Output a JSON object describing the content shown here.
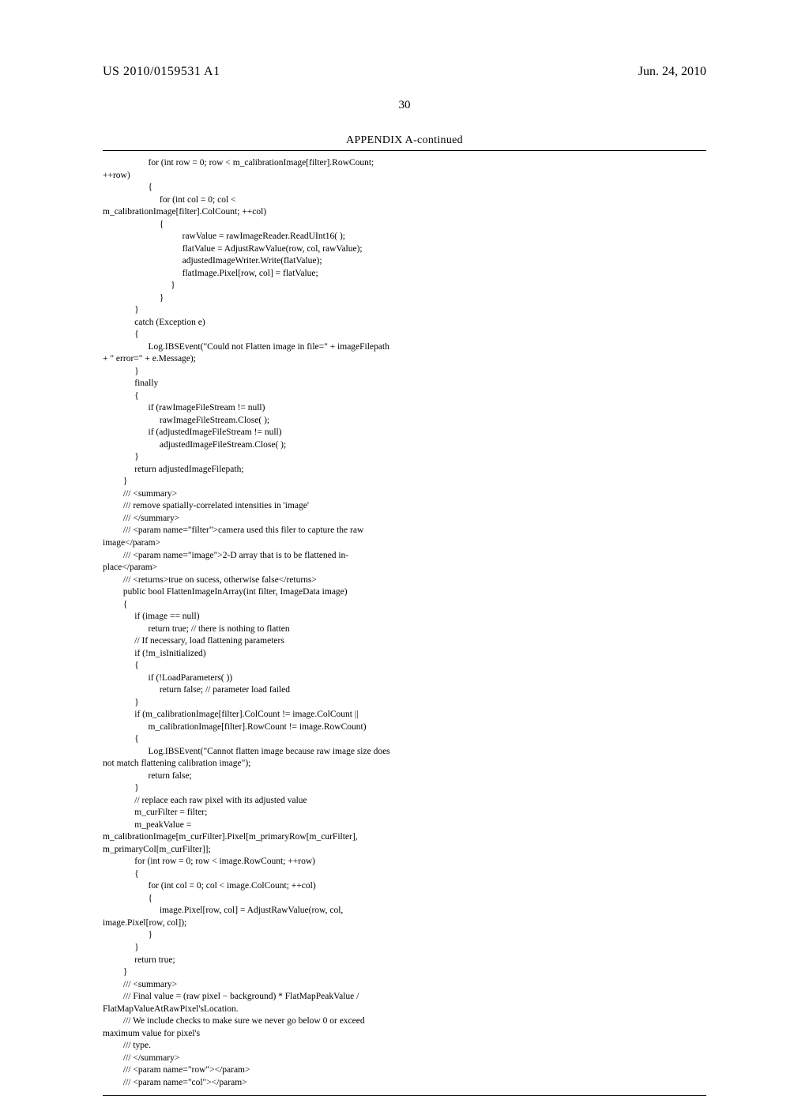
{
  "header": {
    "pub_number": "US 2010/0159531 A1",
    "pub_date": "Jun. 24, 2010"
  },
  "page_number": "30",
  "appendix": {
    "title": "APPENDIX A-continued",
    "code": "                    for (int row = 0; row < m_calibrationImage[filter].RowCount;\n++row)\n                    {\n                         for (int col = 0; col <\nm_calibrationImage[filter].ColCount; ++col)\n                         {\n                                   rawValue = rawImageReader.ReadUInt16( );\n                                   flatValue = AdjustRawValue(row, col, rawValue);\n                                   adjustedImageWriter.Write(flatValue);\n                                   flatImage.Pixel[row, col] = flatValue;\n                              }\n                         }\n              }\n              catch (Exception e)\n              {\n                    Log.IBSEvent(\"Could not Flatten image in file=\" + imageFilepath\n+ \" error=\" + e.Message);\n              }\n              finally\n              {\n                    if (rawImageFileStream != null)\n                         rawImageFileStream.Close( );\n                    if (adjustedImageFileStream != null)\n                         adjustedImageFileStream.Close( );\n              }\n              return adjustedImageFilepath;\n         }\n         /// <summary>\n         /// remove spatially-correlated intensities in 'image'\n         /// </summary>\n         /// <param name=\"filter\">camera used this filer to capture the raw\nimage</param>\n         /// <param name=\"image\">2-D array that is to be flattened in-\nplace</param>\n         /// <returns>true on sucess, otherwise false</returns>\n         public bool FlattenImageInArray(int filter, ImageData image)\n         {\n              if (image == null)\n                    return true; // there is nothing to flatten\n              // If necessary, load flattening parameters\n              if (!m_isInitialized)\n              {\n                    if (!LoadParameters( ))\n                         return false; // parameter load failed\n              }\n              if (m_calibrationImage[filter].ColCount != image.ColCount ||\n                    m_calibrationImage[filter].RowCount != image.RowCount)\n              {\n                    Log.IBSEvent(\"Cannot flatten image because raw image size does\nnot match flattening calibration image\");\n                    return false;\n              }\n              // replace each raw pixel with its adjusted value\n              m_curFilter = filter;\n              m_peakValue =\nm_calibrationImage[m_curFilter].Pixel[m_primaryRow[m_curFilter],\nm_primaryCol[m_curFilter]];\n              for (int row = 0; row < image.RowCount; ++row)\n              {\n                    for (int col = 0; col < image.ColCount; ++col)\n                    {\n                         image.Pixel[row, col] = AdjustRawValue(row, col,\nimage.Pixel[row, col]);\n                    }\n              }\n              return true;\n         }\n         /// <summary>\n         /// Final value = (raw pixel − background) * FlatMapPeakValue /\nFlatMapValueAtRawPixel'sLocation.\n         /// We include checks to make sure we never go below 0 or exceed\nmaximum value for pixel's\n         /// type.\n         /// </summary>\n         /// <param name=\"row\"></param>\n         /// <param name=\"col\"></param>"
  }
}
